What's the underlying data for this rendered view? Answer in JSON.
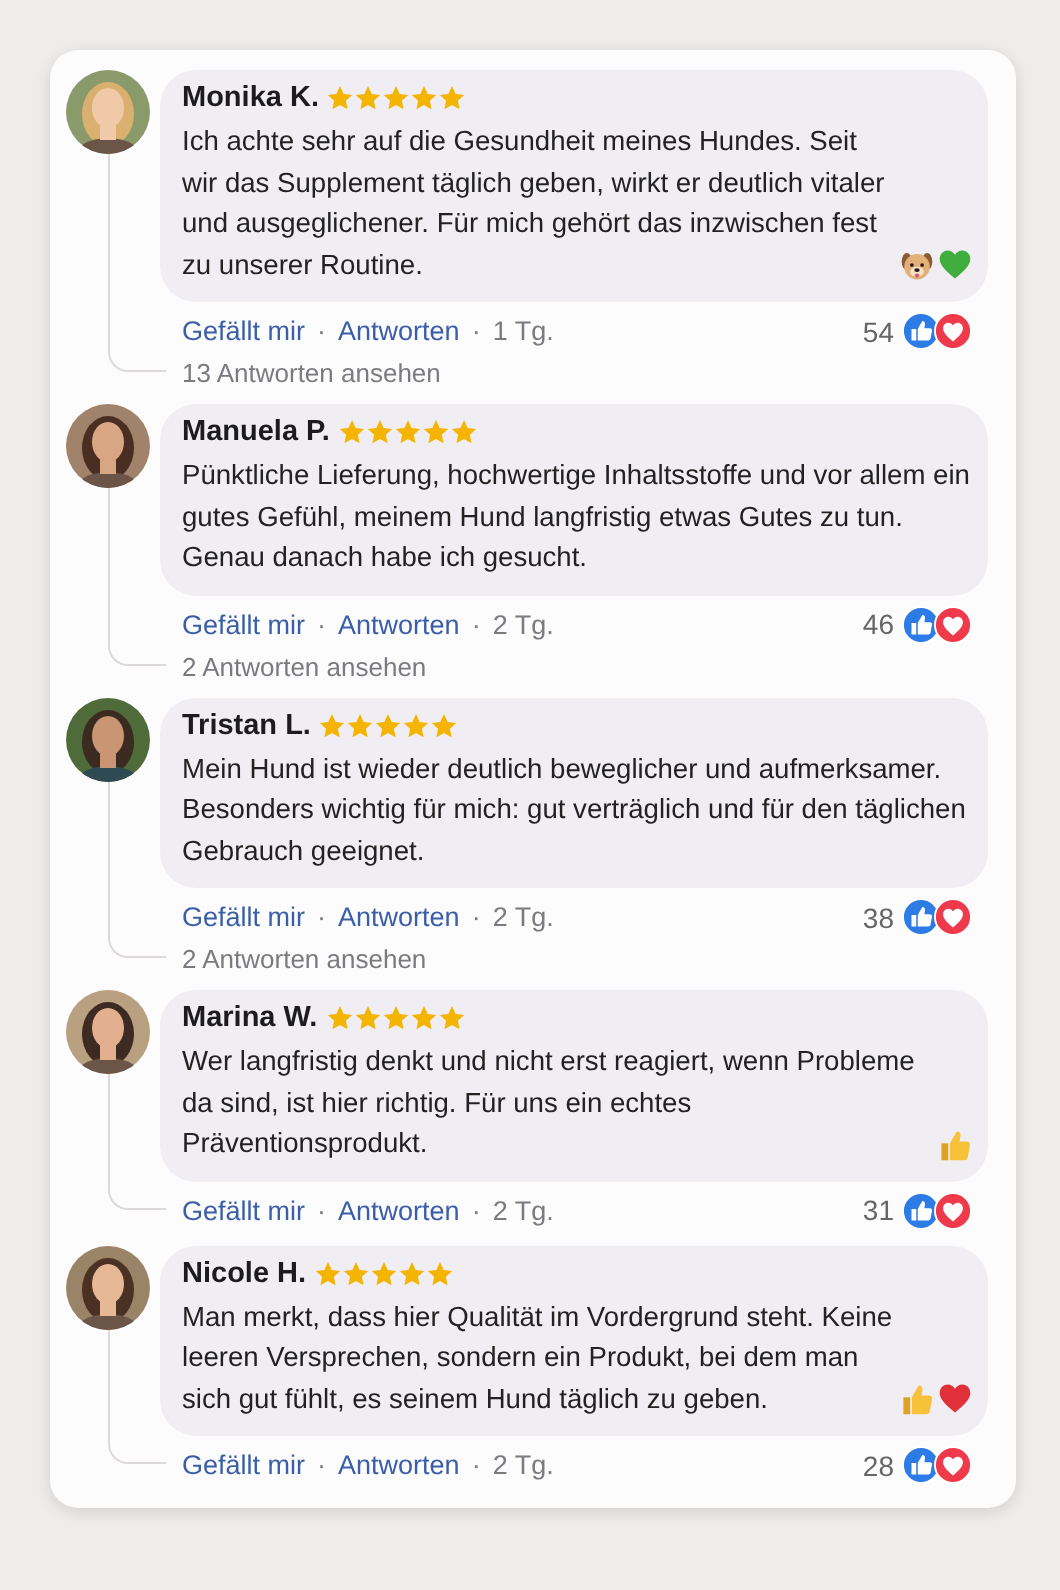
{
  "comments": [
    {
      "author": "Monika K.",
      "stars": 5,
      "text": "Ich achte sehr auf die Gesundheit meines Hundes. Seit wir das Supplement täglich geben, wirkt er deutlich vitaler und ausgeglichener. Für mich gehört das inzwischen fest zu unserer Routine.",
      "emojis": [
        {
          "kind": "dog"
        },
        {
          "kind": "heart",
          "color": "#3fae3f"
        }
      ],
      "like": "Gefällt mir",
      "sep1": "·",
      "reply": "Antworten",
      "sep2": "·",
      "time": "1 Tg.",
      "count": "54",
      "replies": "13 Antworten ansehen"
    },
    {
      "author": "Manuela P.",
      "stars": 5,
      "text": "Pünktliche Lieferung, hochwertige Inhaltsstoffe und vor allem ein gutes Gefühl, meinem Hund langfristig etwas Gutes zu tun. Genau danach habe ich gesucht.",
      "like": "Gefällt mir",
      "sep1": "·",
      "reply": "Antworten",
      "sep2": "·",
      "time": "2 Tg.",
      "count": "46",
      "replies": "2 Antworten ansehen"
    },
    {
      "author": "Tristan L.",
      "stars": 5,
      "text": "Mein Hund ist wieder deutlich beweglicher und aufmerksamer. Besonders wichtig für mich: gut verträglich und für den täglichen Gebrauch geeignet.",
      "like": "Gefällt mir",
      "sep1": "·",
      "reply": "Antworten",
      "sep2": "·",
      "time": "2 Tg.",
      "count": "38",
      "replies": "2 Antworten ansehen"
    },
    {
      "author": "Marina W.",
      "stars": 5,
      "text": "Wer langfristig denkt und nicht erst reagiert, wenn Probleme da sind, ist hier richtig. Für uns ein echtes Präventionsprodukt.",
      "emojis": [
        {
          "kind": "thumb"
        }
      ],
      "like": "Gefällt mir",
      "sep1": "·",
      "reply": "Antworten",
      "sep2": "·",
      "time": "2 Tg.",
      "count": "31"
    },
    {
      "author": "Nicole H.",
      "stars": 5,
      "text": "Man merkt, dass hier Qualität im Vordergrund steht. Keine leeren Versprechen, sondern ein Produkt, bei dem man sich gut fühlt, es seinem Hund täglich zu geben.",
      "emojis": [
        {
          "kind": "thumb"
        },
        {
          "kind": "heart",
          "color": "#e0303a"
        }
      ],
      "like": "Gefällt mir",
      "sep1": "·",
      "reply": "Antworten",
      "sep2": "·",
      "time": "2 Tg.",
      "count": "28"
    }
  ]
}
